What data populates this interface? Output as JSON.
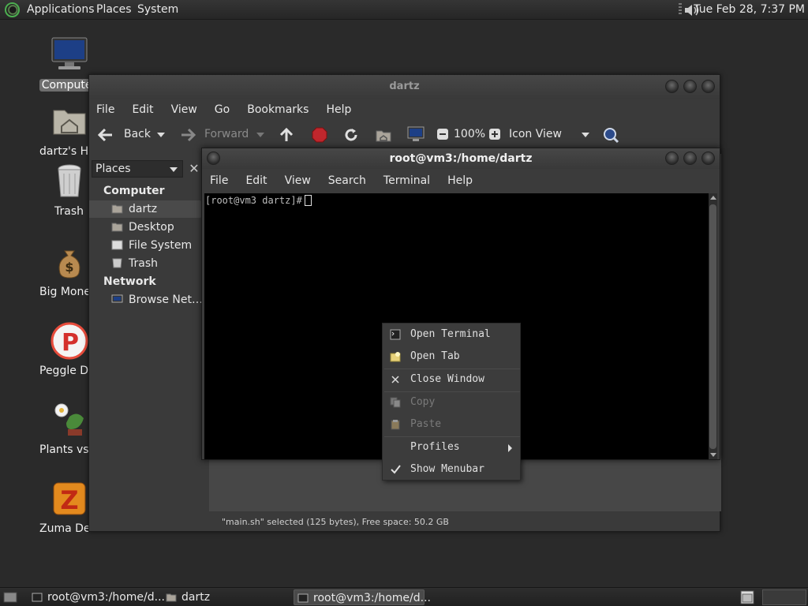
{
  "top_panel": {
    "menus": [
      "Applications",
      "Places",
      "System"
    ],
    "clock": "Tue Feb 28,  7:37 PM"
  },
  "desktop_icons": [
    {
      "label": "Computer",
      "icon": "computer-icon",
      "selected": true
    },
    {
      "label": "dartz's Home",
      "icon": "home-folder-icon"
    },
    {
      "label": "Trash",
      "icon": "trash-icon"
    },
    {
      "label": "Big Money Deluxe",
      "icon": "money-bag-icon"
    },
    {
      "label": "Peggle Deluxe",
      "icon": "peggle-icon"
    },
    {
      "label": "Plants vs Zombies",
      "icon": "plants-vs-zombies-icon"
    },
    {
      "label": "Zuma Deluxe",
      "icon": "zuma-icon"
    }
  ],
  "file_manager": {
    "title": "dartz",
    "menus": [
      "File",
      "Edit",
      "View",
      "Go",
      "Bookmarks",
      "Help"
    ],
    "toolbar": {
      "back": "Back",
      "forward": "Forward",
      "zoom": "100%",
      "view_mode": "Icon View"
    },
    "sidebar": {
      "selector": "Places",
      "sections": [
        {
          "heading": "Computer",
          "items": [
            "dartz",
            "Desktop",
            "File System",
            "Trash"
          ]
        },
        {
          "heading": "Network",
          "items": [
            "Browse Net…"
          ]
        }
      ],
      "selected_item": "dartz"
    },
    "status": "\"main.sh\" selected (125 bytes), Free space: 50.2 GB"
  },
  "terminal": {
    "title": "root@vm3:/home/dartz",
    "menus": [
      "File",
      "Edit",
      "View",
      "Search",
      "Terminal",
      "Help"
    ],
    "prompt": "[root@vm3 dartz]#"
  },
  "context_menu": {
    "items": [
      {
        "label": "Open Terminal",
        "icon": "terminal-icon",
        "enabled": true
      },
      {
        "label": "Open Tab",
        "icon": "new-tab-icon",
        "enabled": true
      },
      {
        "label": "Close Window",
        "icon": "close-icon",
        "enabled": true
      },
      {
        "label": "Copy",
        "icon": "copy-icon",
        "enabled": false
      },
      {
        "label": "Paste",
        "icon": "paste-icon",
        "enabled": false
      },
      {
        "label": "Profiles",
        "icon": "",
        "enabled": true,
        "submenu": true
      },
      {
        "label": "Show Menubar",
        "icon": "check-icon",
        "enabled": true,
        "checked": true
      }
    ]
  },
  "taskbar": {
    "tasks": [
      {
        "label": "root@vm3:/home/d...",
        "icon": "terminal-icon",
        "active": false
      },
      {
        "label": "dartz",
        "icon": "home-folder-icon",
        "active": false
      },
      {
        "label": "root@vm3:/home/d...",
        "icon": "terminal-icon",
        "active": true
      }
    ]
  },
  "colors": {
    "desktop_bg": "#2a2a2a",
    "window_bg": "#3a3a3a",
    "terminal_bg": "#000000",
    "accent_record": "#c0272d"
  }
}
